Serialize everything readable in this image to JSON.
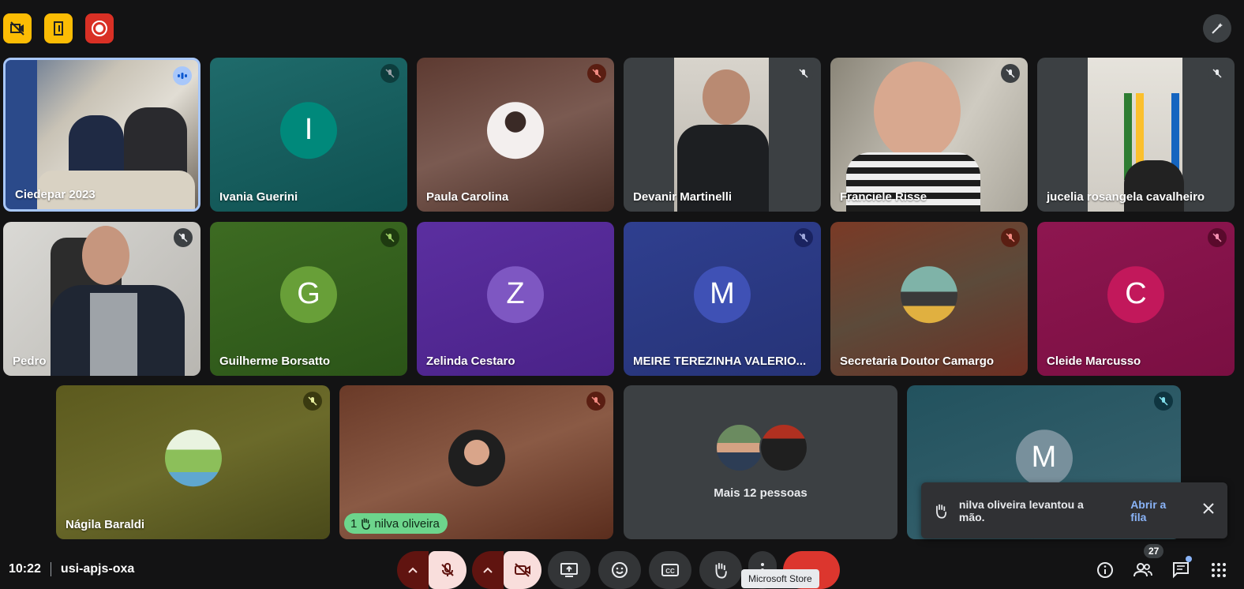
{
  "meeting": {
    "time": "10:22",
    "code": "usi-apjs-oxa",
    "participants_count": "27"
  },
  "tiles": [
    {
      "name": "Ciedepar 2023"
    },
    {
      "name": "Ivania Guerini",
      "initial": "I"
    },
    {
      "name": "Paula Carolina"
    },
    {
      "name": "Devanir Martinelli"
    },
    {
      "name": "Franciele Risse"
    },
    {
      "name": "jucelia rosangela cavalheiro"
    },
    {
      "name": "Pedro"
    },
    {
      "name": "Guilherme Borsatto",
      "initial": "G"
    },
    {
      "name": "Zelinda Cestaro",
      "initial": "Z"
    },
    {
      "name": "MEIRE TEREZINHA VALERIO...",
      "initial": "M"
    },
    {
      "name": "Secretaria Doutor Camargo"
    },
    {
      "name": "Cleide Marcusso",
      "initial": "C"
    },
    {
      "name": "Nágila Baraldi"
    },
    {
      "name": "nilva oliveira",
      "hand_number": "1"
    },
    {
      "name": "Mais 12 pessoas"
    },
    {
      "name": "M",
      "initial": "M"
    }
  ],
  "toast": {
    "message": "nilva oliveira levantou a mão.",
    "action": "Abrir a fila"
  },
  "tooltip": "Microsoft Store",
  "colors": {
    "accent": "#8ab4f8",
    "leave": "#dc362e",
    "raised_hand": "#6dd58c"
  }
}
